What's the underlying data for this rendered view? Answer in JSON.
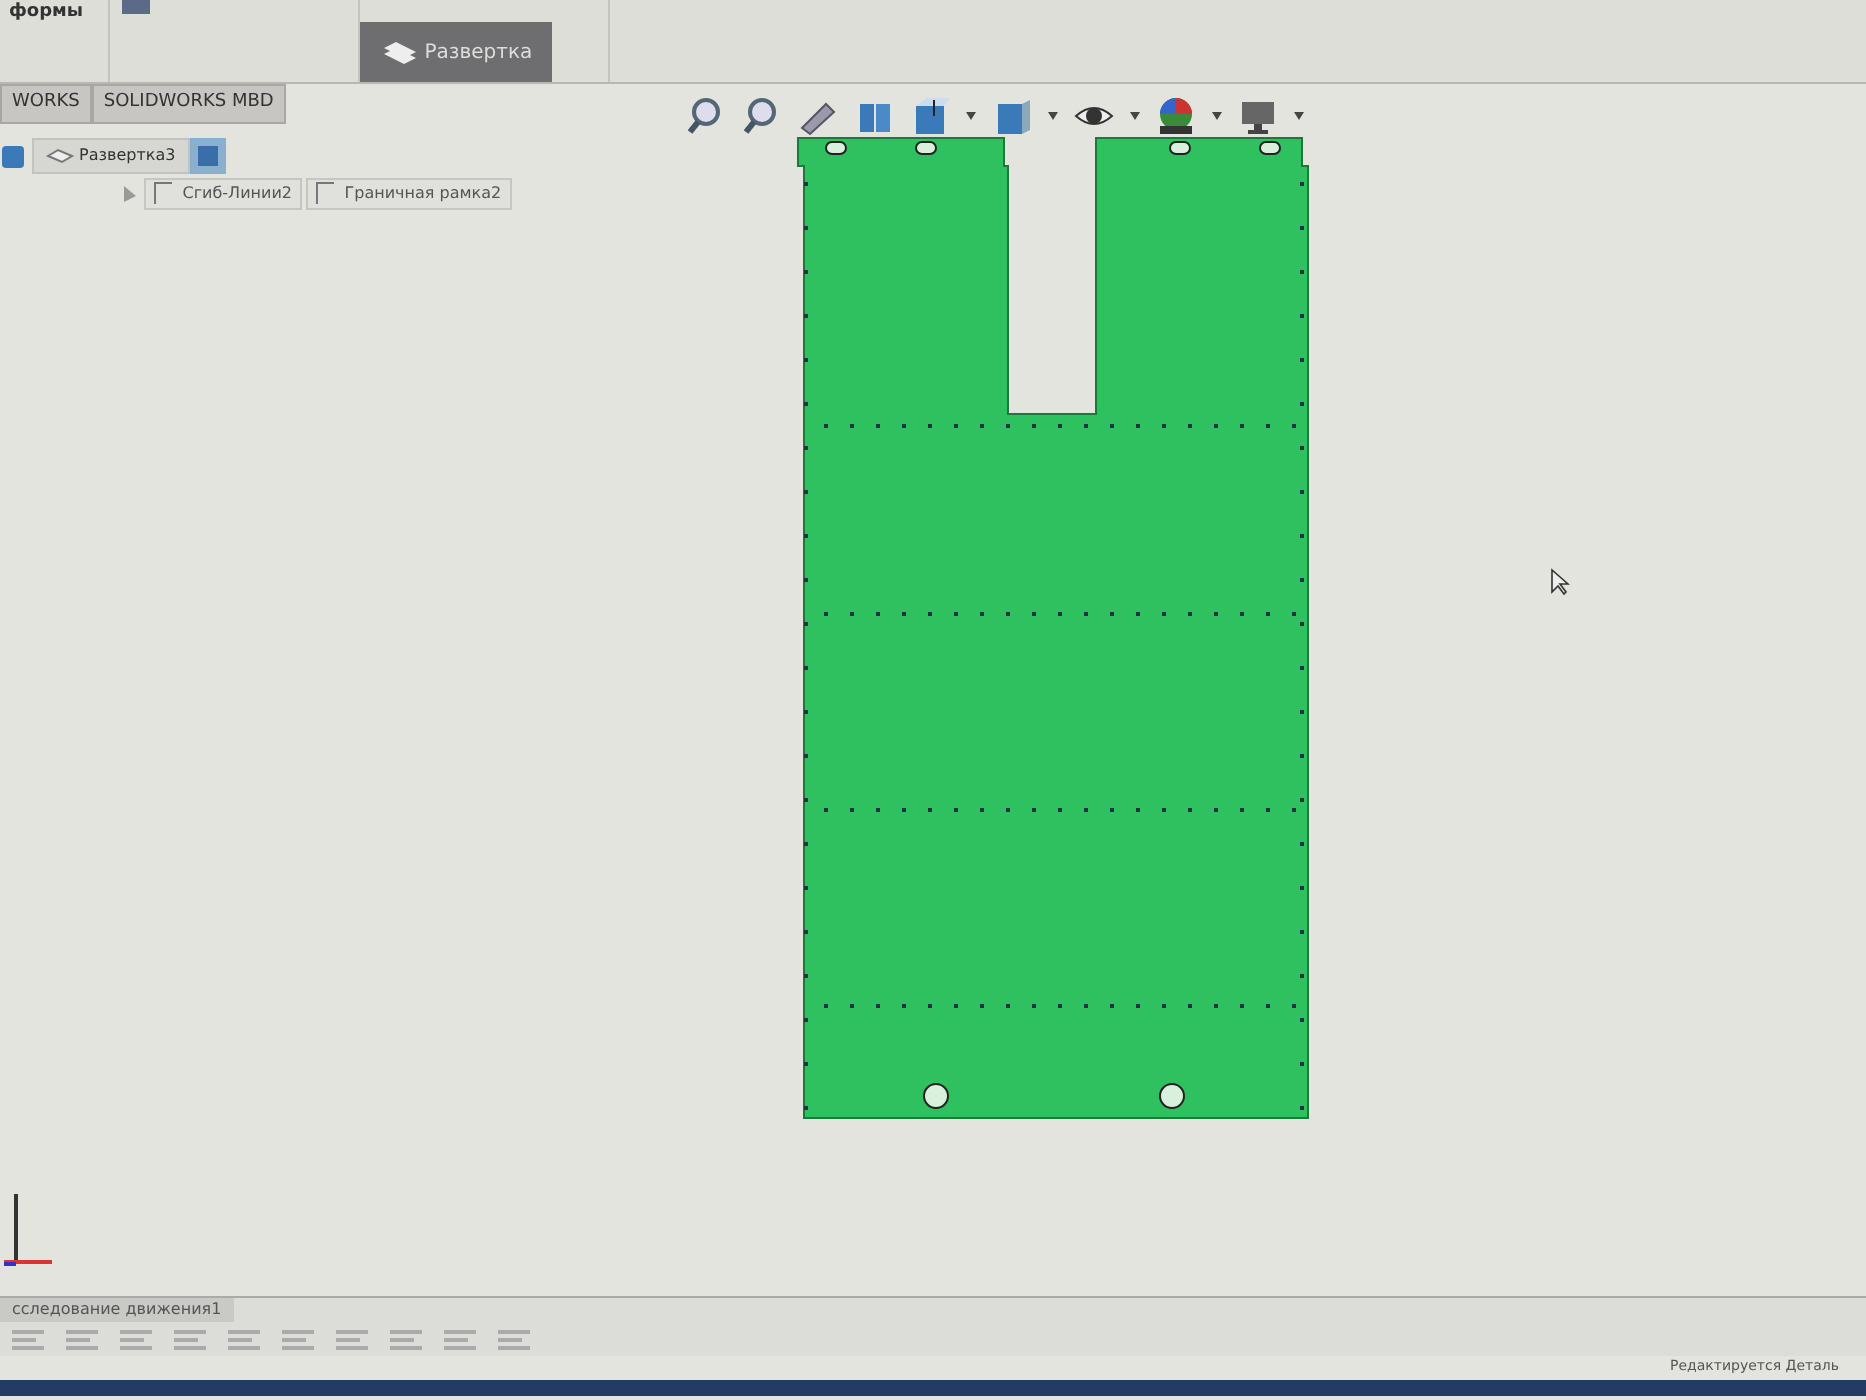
{
  "ribbon": {
    "left_label": "формы",
    "buttons": [
      {
        "label": "Развертка",
        "selected": true
      }
    ]
  },
  "tabs": [
    {
      "label": "WORKS"
    },
    {
      "label": "SOLIDWORKS MBD"
    }
  ],
  "view_toolbar": [
    {
      "kind": "zoom",
      "dropdown": false
    },
    {
      "kind": "zoom",
      "dropdown": false
    },
    {
      "kind": "pen",
      "dropdown": false
    },
    {
      "kind": "section",
      "dropdown": false
    },
    {
      "kind": "orient",
      "dropdown": true
    },
    {
      "kind": "display",
      "dropdown": true
    },
    {
      "kind": "eye",
      "dropdown": true
    },
    {
      "kind": "ball",
      "dropdown": true
    },
    {
      "kind": "monitor",
      "dropdown": true
    }
  ],
  "breadcrumb": {
    "items": [
      "Развертка3"
    ]
  },
  "features": [
    "Сгиб-Линии2",
    "Граничная рамка2"
  ],
  "motion_tab": {
    "label": "сследование движения1"
  },
  "status_bar": {
    "text": "Редактируется Деталь"
  }
}
